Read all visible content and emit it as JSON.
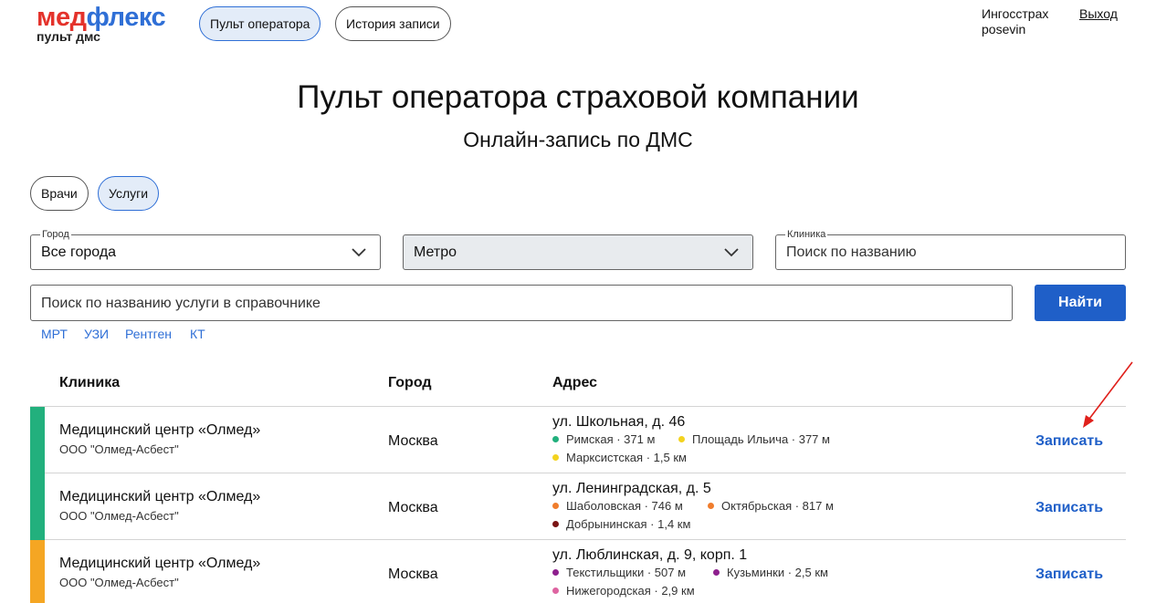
{
  "header": {
    "logo": {
      "part1": "мед",
      "part2": "флекс",
      "subtitle": "пульт дмс"
    },
    "nav": [
      {
        "label": "Пульт оператора",
        "active": true
      },
      {
        "label": "История записи",
        "active": false
      }
    ],
    "company": "Ингосстрах",
    "username": "posevin",
    "logout_label": "Выход"
  },
  "page": {
    "title": "Пульт оператора страховой компании",
    "subtitle": "Онлайн-запись по ДМС"
  },
  "mode_tabs": [
    {
      "label": "Врачи",
      "active": false
    },
    {
      "label": "Услуги",
      "active": true
    }
  ],
  "filters": {
    "city": {
      "label": "Город",
      "value": "Все города"
    },
    "metro": {
      "value": "Метро"
    },
    "clinic": {
      "label": "Клиника",
      "placeholder": "Поиск по названию"
    }
  },
  "search": {
    "placeholder": "Поиск по названию услуги в справочнике",
    "button_label": "Найти",
    "quick_tags": [
      "МРТ",
      "УЗИ",
      "Рентген",
      "КТ"
    ]
  },
  "table": {
    "headers": {
      "clinic": "Клиника",
      "city": "Город",
      "address": "Адрес"
    },
    "book_label": "Записать",
    "rows": [
      {
        "strip_color": "#22b07d",
        "clinic": "Медицинский центр «Олмед»",
        "org": "ООО \"Олмед-Асбест\"",
        "city": "Москва",
        "address": "ул. Школьная, д. 46",
        "metro": [
          {
            "text": "Римская · 371 м",
            "color": "#22b07d"
          },
          {
            "text": "Площадь Ильича · 377 м",
            "color": "#f3d31f"
          },
          {
            "text": "Марксистская · 1,5 км",
            "color": "#f3d31f"
          }
        ]
      },
      {
        "strip_color": "#22b07d",
        "clinic": "Медицинский центр «Олмед»",
        "org": "ООО \"Олмед-Асбест\"",
        "city": "Москва",
        "address": "ул. Ленинградская, д. 5",
        "metro": [
          {
            "text": "Шаболовская · 746 м",
            "color": "#f07d2d"
          },
          {
            "text": "Октябрьская · 817 м",
            "color": "#f07d2d"
          },
          {
            "text": "Добрынинская · 1,4 км",
            "color": "#7a1414"
          }
        ]
      },
      {
        "strip_color": "#f5a623",
        "clinic": "Медицинский центр «Олмед»",
        "org": "ООО \"Олмед-Асбест\"",
        "city": "Москва",
        "address": "ул. Люблинская, д. 9, корп. 1",
        "metro": [
          {
            "text": "Текстильщики · 507 м",
            "color": "#8e1f8e"
          },
          {
            "text": "Кузьминки · 2,5 км",
            "color": "#8e1f8e"
          },
          {
            "text": "Нижегородская · 2,9 км",
            "color": "#de64a1"
          }
        ]
      }
    ]
  },
  "colors": {
    "accent": "#1f5fc8",
    "logo_red": "#e4322b",
    "logo_blue": "#2f6fd6",
    "annotation_arrow": "#e0201b"
  }
}
